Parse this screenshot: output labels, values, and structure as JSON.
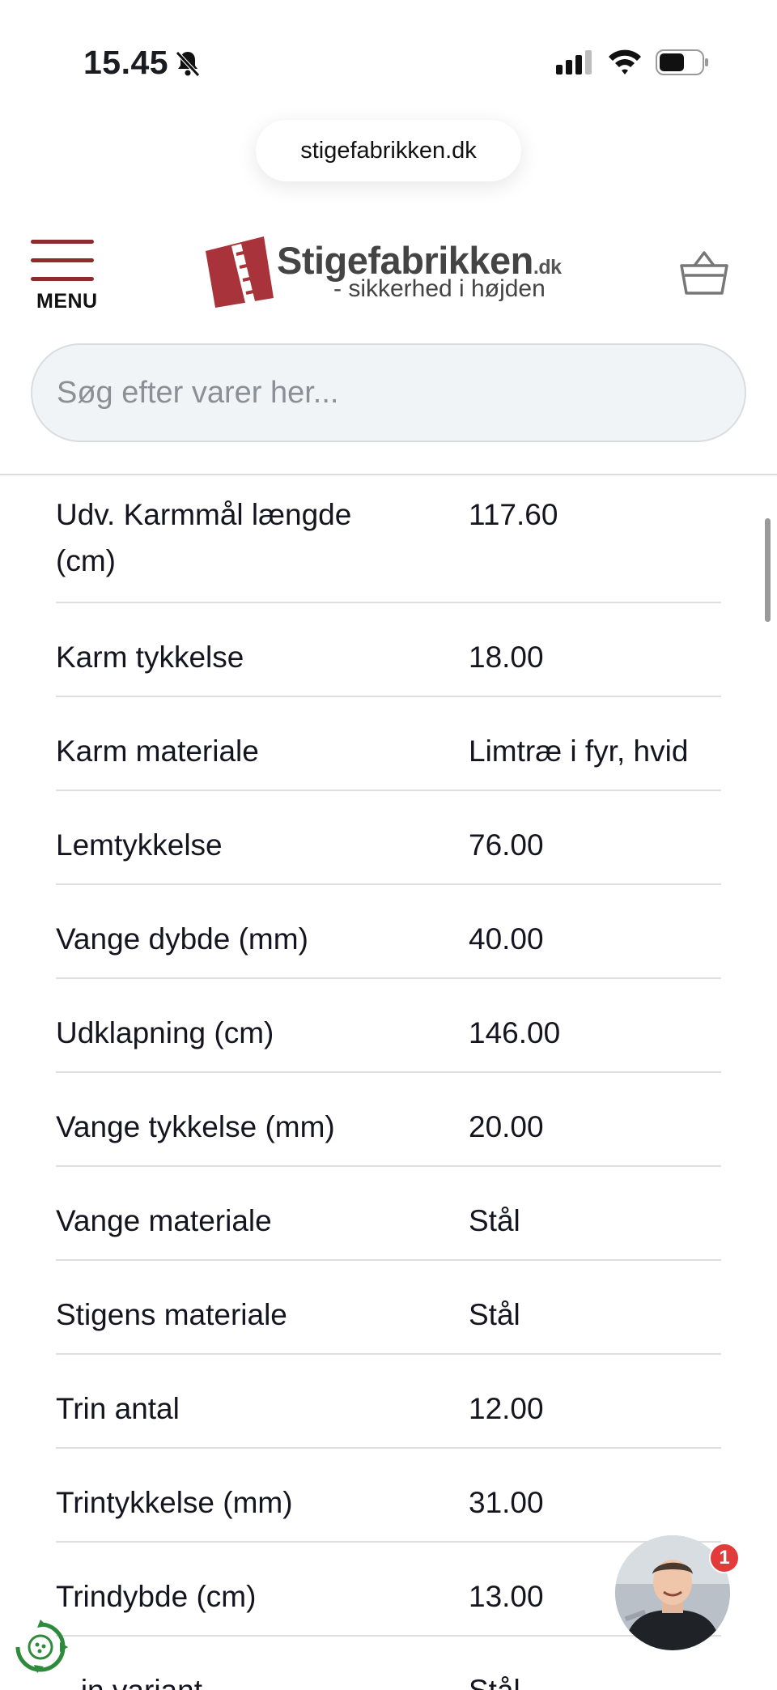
{
  "status_bar": {
    "time": "15.45",
    "icons": [
      "bell-slash-icon",
      "signal-icon",
      "wifi-icon",
      "battery-icon"
    ]
  },
  "browser": {
    "url": "stigefabrikken.dk"
  },
  "header": {
    "menu_label": "MENU",
    "logo": {
      "name": "Stigefabrikken",
      "tld": ".dk",
      "tagline": "- sikkerhed i højden"
    },
    "search_placeholder": "Søg efter varer her...",
    "brand_color": "#8e2b2b"
  },
  "specs": [
    {
      "label": "Udv. Karmmål længde (cm)",
      "value": "117.60"
    },
    {
      "label": "Karm tykkelse",
      "value": "18.00"
    },
    {
      "label": "Karm materiale",
      "value": "Limtræ i fyr, hvid"
    },
    {
      "label": "Lemtykkelse",
      "value": "76.00"
    },
    {
      "label": "Vange dybde (mm)",
      "value": "40.00"
    },
    {
      "label": "Udklapning (cm)",
      "value": "146.00"
    },
    {
      "label": "Vange tykkelse (mm)",
      "value": "20.00"
    },
    {
      "label": "Vange materiale",
      "value": "Stål"
    },
    {
      "label": "Stigens materiale",
      "value": "Stål"
    },
    {
      "label": "Trin antal",
      "value": "12.00"
    },
    {
      "label": "Trintykkelse (mm)",
      "value": "31.00"
    },
    {
      "label": "Trindybde (cm)",
      "value": "13.00"
    },
    {
      "label": "...in variant",
      "value": "Stål"
    }
  ],
  "chat": {
    "badge_count": "1"
  }
}
